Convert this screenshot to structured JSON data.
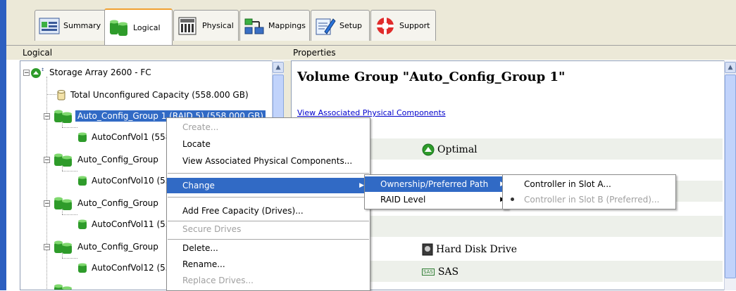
{
  "tabs": [
    {
      "label": "Summary",
      "icon": "summary-icon"
    },
    {
      "label": "Logical",
      "icon": "logical-icon",
      "active": true
    },
    {
      "label": "Physical",
      "icon": "physical-icon"
    },
    {
      "label": "Mappings",
      "icon": "mappings-icon"
    },
    {
      "label": "Setup",
      "icon": "setup-icon"
    },
    {
      "label": "Support",
      "icon": "support-icon"
    }
  ],
  "left_pane": {
    "title": "Logical",
    "tree": [
      {
        "label": "Storage Array 2600 - FC",
        "icon": "storage-array-icon"
      },
      {
        "label": "Total Unconfigured Capacity (558.000 GB)",
        "icon": "unconfigured-capacity-icon"
      },
      {
        "label": "Auto_Config_Group 1 (RAID 5) (558.000 GB)",
        "icon": "volume-group-icon",
        "selected": true
      },
      {
        "label": "AutoConfVol1 (558",
        "icon": "volume-icon"
      },
      {
        "label": "Auto_Config_Group",
        "icon": "volume-group-icon"
      },
      {
        "label": "AutoConfVol10 (55",
        "icon": "volume-icon"
      },
      {
        "label": "Auto_Config_Group",
        "icon": "volume-group-icon"
      },
      {
        "label": "AutoConfVol11 (55",
        "icon": "volume-icon"
      },
      {
        "label": "Auto_Config_Group",
        "icon": "volume-group-icon"
      },
      {
        "label": "AutoConfVol12 (55",
        "icon": "volume-icon"
      }
    ]
  },
  "right_pane": {
    "title": "Properties",
    "heading": "Volume Group \"Auto_Config_Group 1\"",
    "link": "View Associated Physical Components",
    "values": [
      {
        "text": "Optimal",
        "icon": "optimal-status-icon"
      },
      {
        "text": "Hard Disk Drive",
        "icon": "hard-disk-icon"
      },
      {
        "text": "SAS",
        "icon": "sas-icon",
        "badge": "SAS"
      }
    ]
  },
  "context_menu": {
    "items": [
      {
        "label": "Create...",
        "disabled": true
      },
      {
        "label": "Locate"
      },
      {
        "label": "View Associated Physical Components..."
      },
      {
        "label": "Change",
        "submenu": true,
        "highlighted": true
      },
      {
        "label": "Add Free Capacity (Drives)..."
      },
      {
        "label": "Secure Drives",
        "disabled": true
      },
      {
        "label": "Delete..."
      },
      {
        "label": "Rename..."
      },
      {
        "label": "Replace Drives...",
        "disabled": true
      }
    ]
  },
  "change_submenu": {
    "items": [
      {
        "label": "Ownership/Preferred Path",
        "submenu": true,
        "highlighted": true
      },
      {
        "label": "RAID Level",
        "submenu": true
      }
    ]
  },
  "ownership_submenu": {
    "items": [
      {
        "label": "Controller in Slot A..."
      },
      {
        "label": "Controller in Slot B (Preferred)...",
        "disabled": true,
        "checked": true
      }
    ]
  },
  "colors": {
    "selection": "#316ac5",
    "active_tab_accent": "#f0a030",
    "volume_green": "#2e9b2a"
  }
}
